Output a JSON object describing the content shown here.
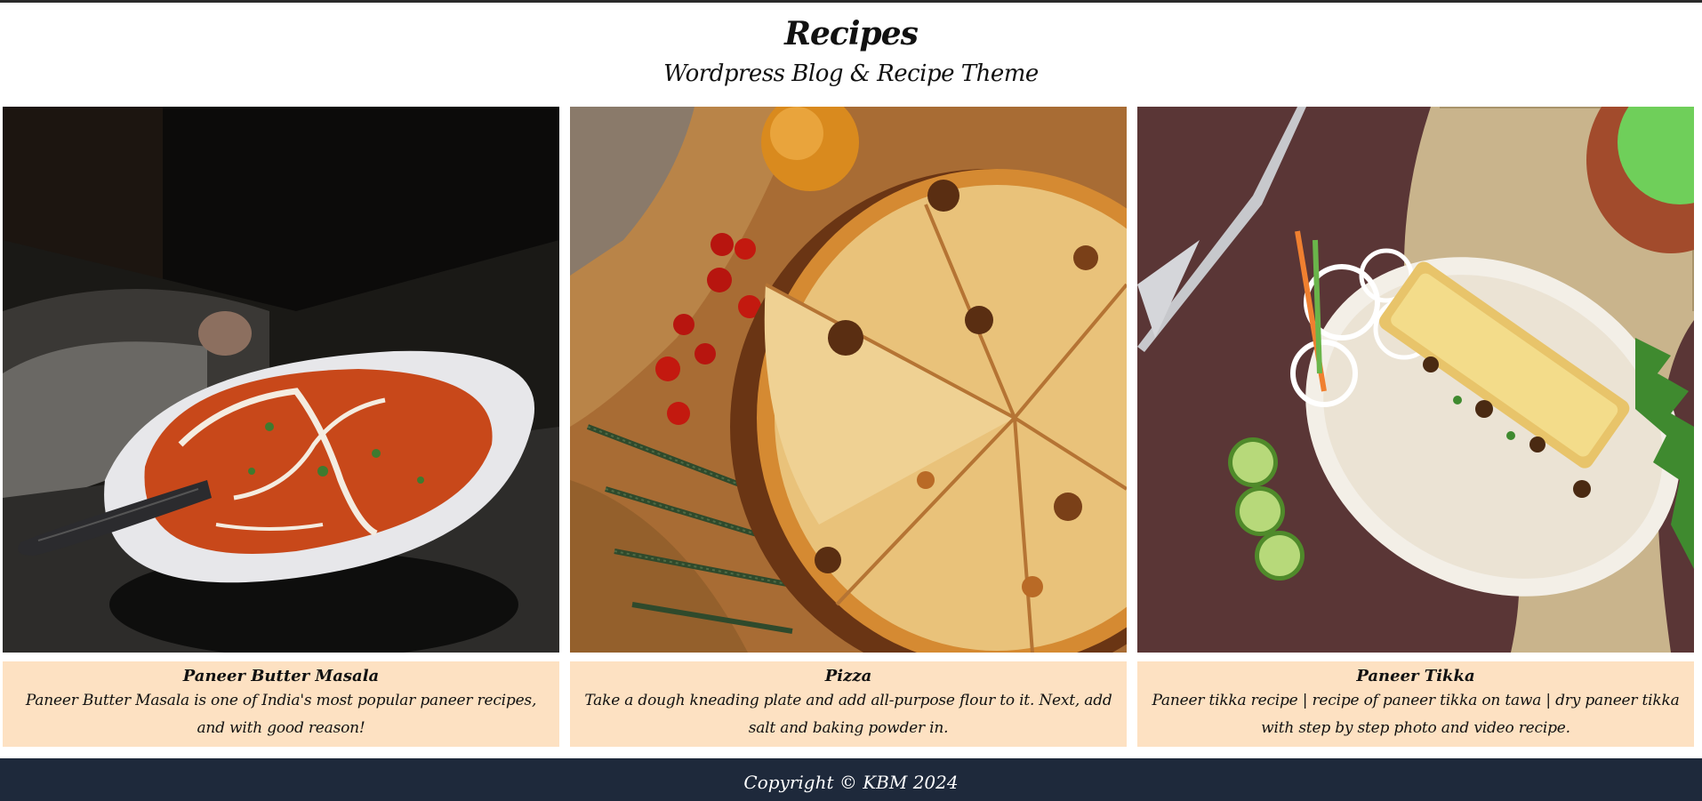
{
  "header": {
    "title": "Recipes",
    "tagline": "Wordpress Blog & Recipe Theme"
  },
  "recipes": [
    {
      "title": "Paneer Butter Masala",
      "description": "Paneer Butter Masala is one of India's most popular paneer recipes, and with good reason!"
    },
    {
      "title": "Pizza",
      "description": "Take a dough kneading plate and add all-purpose flour to it. Next, add salt and baking powder in."
    },
    {
      "title": "Paneer Tikka",
      "description": "Paneer tikka recipe | recipe of paneer tikka on tawa | dry paneer tikka with step by step photo and video recipe."
    }
  ],
  "footer": {
    "copyright": "Copyright © KBM 2024"
  },
  "colors": {
    "caption_bg": "#fde1c2",
    "footer_bg": "#1e293b",
    "top_border": "#2a2a2a"
  }
}
